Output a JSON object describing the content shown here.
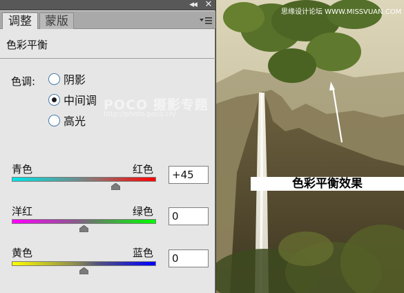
{
  "panel": {
    "tabs": [
      {
        "label": "调整"
      },
      {
        "label": "蒙版"
      }
    ],
    "title": "色彩平衡",
    "tone": {
      "label": "色调:",
      "options": [
        {
          "label": "阴影",
          "checked": false
        },
        {
          "label": "中间调",
          "checked": true
        },
        {
          "label": "高光",
          "checked": false
        }
      ]
    },
    "sliders": [
      {
        "left": "青色",
        "right": "红色",
        "value": "+45",
        "level": 0.72
      },
      {
        "left": "洋红",
        "right": "绿色",
        "value": "0",
        "level": 0.5
      },
      {
        "left": "黄色",
        "right": "蓝色",
        "value": "0",
        "level": 0.5
      }
    ]
  },
  "watermark": {
    "brand": "POCO 摄影专题",
    "url": "http://photo.poco.cn/"
  },
  "photo": {
    "site_text": "思缘设计论坛 WWW.MISSVUAN.COM",
    "effect_label": "色彩平衡效果"
  }
}
